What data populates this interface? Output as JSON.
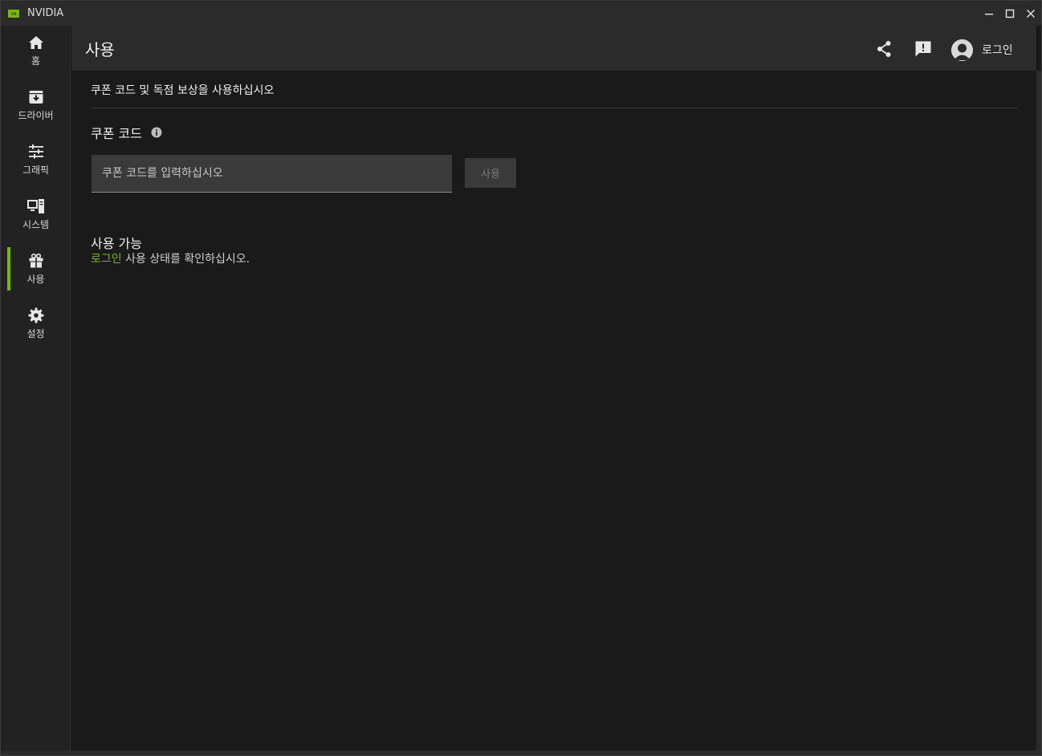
{
  "window": {
    "title": "NVIDIA",
    "controls": [
      "minimize",
      "maximize",
      "close"
    ]
  },
  "colors": {
    "accent": "#76b900",
    "background": "#1a1a1a",
    "panel": "#2b2b2b"
  },
  "sidebar": {
    "items": [
      {
        "id": "home",
        "label": "홈",
        "icon": "home-icon",
        "active": false
      },
      {
        "id": "drivers",
        "label": "드라이버",
        "icon": "driver-download-icon",
        "active": false
      },
      {
        "id": "graphics",
        "label": "그래픽",
        "icon": "sliders-icon",
        "active": false
      },
      {
        "id": "system",
        "label": "시스템",
        "icon": "computer-icon",
        "active": false
      },
      {
        "id": "redeem",
        "label": "사용",
        "icon": "gift-icon",
        "active": true
      },
      {
        "id": "settings",
        "label": "설정",
        "icon": "gear-icon",
        "active": false
      }
    ]
  },
  "header": {
    "title": "사용",
    "icons": [
      "share-icon",
      "feedback-icon",
      "avatar-icon"
    ],
    "login_label": "로그인"
  },
  "main": {
    "subtitle": "쿠폰 코드 및 독점 보상을 사용하십시오",
    "coupon": {
      "title": "쿠폰 코드",
      "input_placeholder": "쿠폰 코드를 입력하십시오",
      "input_value": "",
      "redeem_button": "사용",
      "redeem_enabled": false
    },
    "available": {
      "title": "사용 가능",
      "login_link": "로그인",
      "status_text": " 사용 상태를 확인하십시오."
    }
  }
}
